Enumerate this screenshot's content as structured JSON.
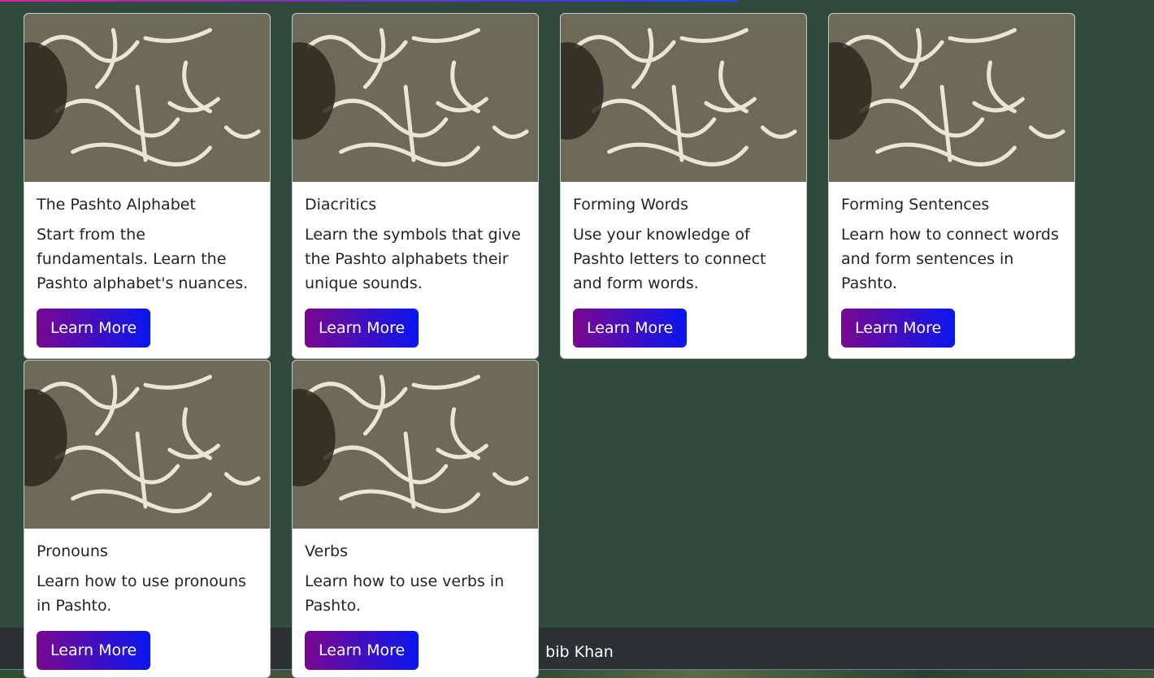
{
  "cards": [
    {
      "title": "The Pashto Alphabet",
      "text": "Start from the fundamentals. Learn the Pashto alphabet's nuances.",
      "button": "Learn More"
    },
    {
      "title": "Diacritics",
      "text": "Learn the symbols that give the Pashto alphabets their unique sounds.",
      "button": "Learn More"
    },
    {
      "title": "Forming Words",
      "text": "Use your knowledge of Pashto letters to connect and form words.",
      "button": "Learn More"
    },
    {
      "title": "Forming Sentences",
      "text": "Learn how to connect words and form sentences in Pashto.",
      "button": "Learn More"
    },
    {
      "title": "Pronouns",
      "text": "Learn how to use pronouns in Pashto.",
      "button": "Learn More"
    },
    {
      "title": "Verbs",
      "text": "Learn how to use verbs in Pashto.",
      "button": "Learn More"
    }
  ],
  "footer": {
    "text": "bib Khan"
  },
  "colors": {
    "background": "#304a3e",
    "button_start": "#7a078f",
    "button_end": "#0a16f0",
    "footer": "#2b3133"
  }
}
